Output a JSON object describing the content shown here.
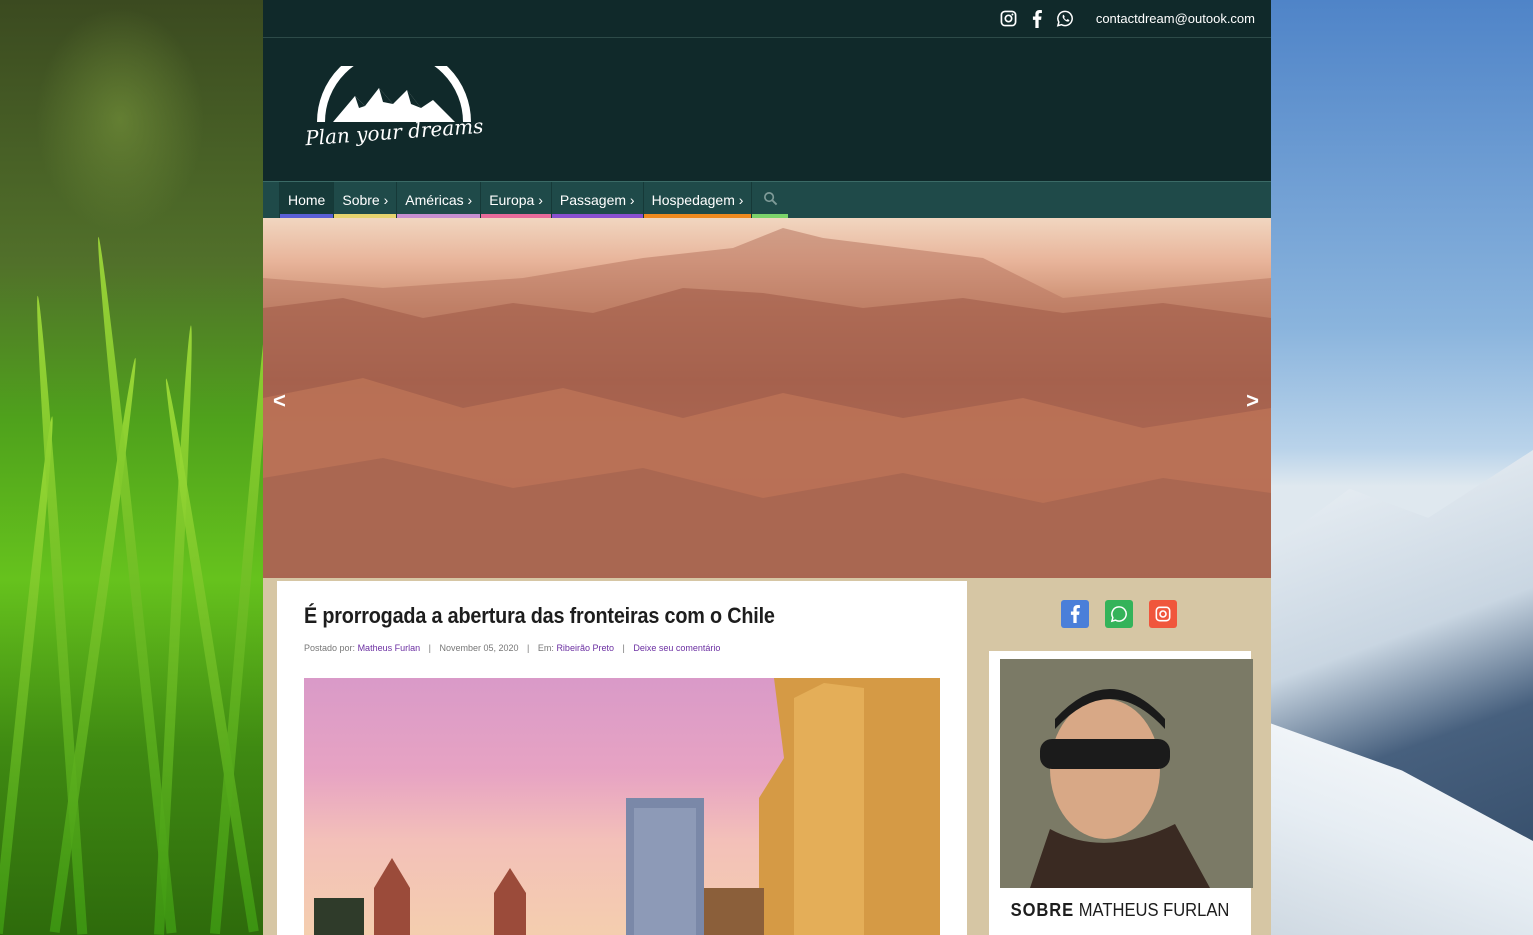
{
  "topbar": {
    "icons": [
      "instagram-icon",
      "facebook-icon",
      "whatsapp-icon"
    ],
    "email": "contactdream@outook.com"
  },
  "logo": {
    "text": "Plan your dreams"
  },
  "nav": {
    "items": [
      {
        "label": "Home",
        "color": "#5a5fd6"
      },
      {
        "label": "Sobre ›",
        "color": "#e6d36e"
      },
      {
        "label": "Américas ›",
        "color": "#c78fd0"
      },
      {
        "label": "Europa ›",
        "color": "#e86b9a"
      },
      {
        "label": "Passagem ›",
        "color": "#8a4fd0"
      },
      {
        "label": "Hospedagem ›",
        "color": "#ef8a1f"
      }
    ],
    "search_color": "#7cd36a"
  },
  "hero": {
    "prev": "<",
    "next": ">"
  },
  "post": {
    "title": "É prorrogada a abertura das fronteiras com o Chile",
    "meta": {
      "posted_by_label": "Postado por:",
      "author": "Matheus Furlan",
      "date": "November 05, 2020",
      "in_label": "Em:",
      "category": "Ribeirão Preto",
      "comment": "Deixe seu comentário"
    }
  },
  "sidebar": {
    "social": [
      {
        "icon": "facebook-icon",
        "color": "#4a7fd9"
      },
      {
        "icon": "whatsapp-icon",
        "color": "#34b35a"
      },
      {
        "icon": "instagram-icon",
        "color": "#f0563c"
      }
    ],
    "about": {
      "bold": "SOBRE",
      "name": "MATHEUS FURLAN"
    }
  }
}
